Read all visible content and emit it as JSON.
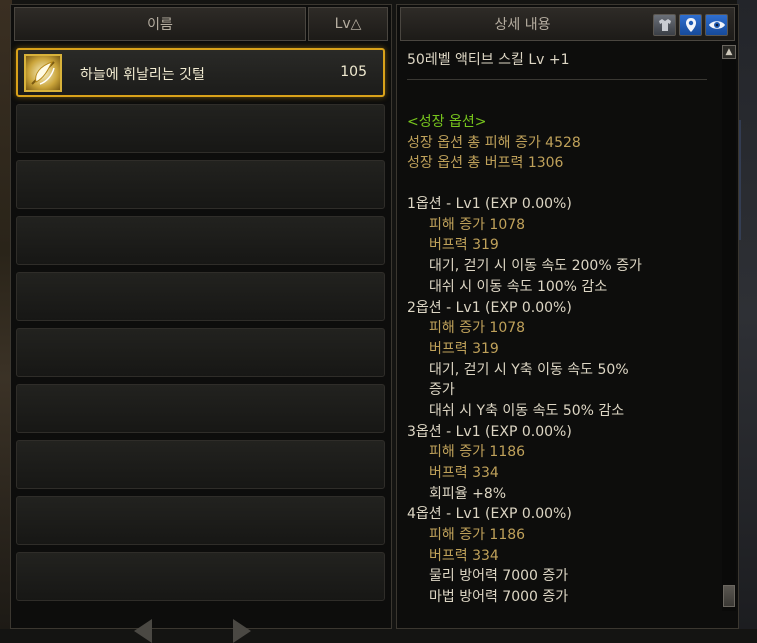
{
  "header": {
    "name_col": "이름",
    "lv_col": "Lv△",
    "detail_col": "상세 내용"
  },
  "icons": [
    "appearance-icon",
    "location-icon",
    "eye-icon"
  ],
  "list": {
    "items": [
      {
        "name": "하늘에 휘날리는 깃털",
        "lv": "105",
        "icon": "feather-icon"
      }
    ]
  },
  "detail": {
    "subtitle": "50레벨 액티브 스킬 Lv +1",
    "growth_header": "<성장 옵션>",
    "growth_total_damage": "성장 옵션 총 피해 증가 4528",
    "growth_total_buff": "성장 옵션 총 버프력 1306",
    "opt1_header": "1옵션 - Lv1 (EXP 0.00%)",
    "opt1_l1": "피해 증가 1078",
    "opt1_l2": "버프력 319",
    "opt1_l3": "대기, 걷기 시 이동 속도 200% 증가",
    "opt1_l4": "대쉬 시 이동 속도 100% 감소",
    "opt2_header": "2옵션 - Lv1 (EXP 0.00%)",
    "opt2_l1": "피해 증가 1078",
    "opt2_l2": "버프력 319",
    "opt2_l3a": "대기, 걷기 시 Y축 이동 속도 50%",
    "opt2_l3b": "증가",
    "opt2_l4": "대쉬 시 Y축 이동 속도 50% 감소",
    "opt3_header": "3옵션 - Lv1 (EXP 0.00%)",
    "opt3_l1": "피해 증가 1186",
    "opt3_l2": "버프력 334",
    "opt3_l3": "회피율 +8%",
    "opt4_header": "4옵션 - Lv1 (EXP 0.00%)",
    "opt4_l1": "피해 증가 1186",
    "opt4_l2": "버프력 334",
    "opt4_l3": "물리 방어력 7000 증가",
    "opt4_l4": "마법 방어력 7000 증가"
  }
}
